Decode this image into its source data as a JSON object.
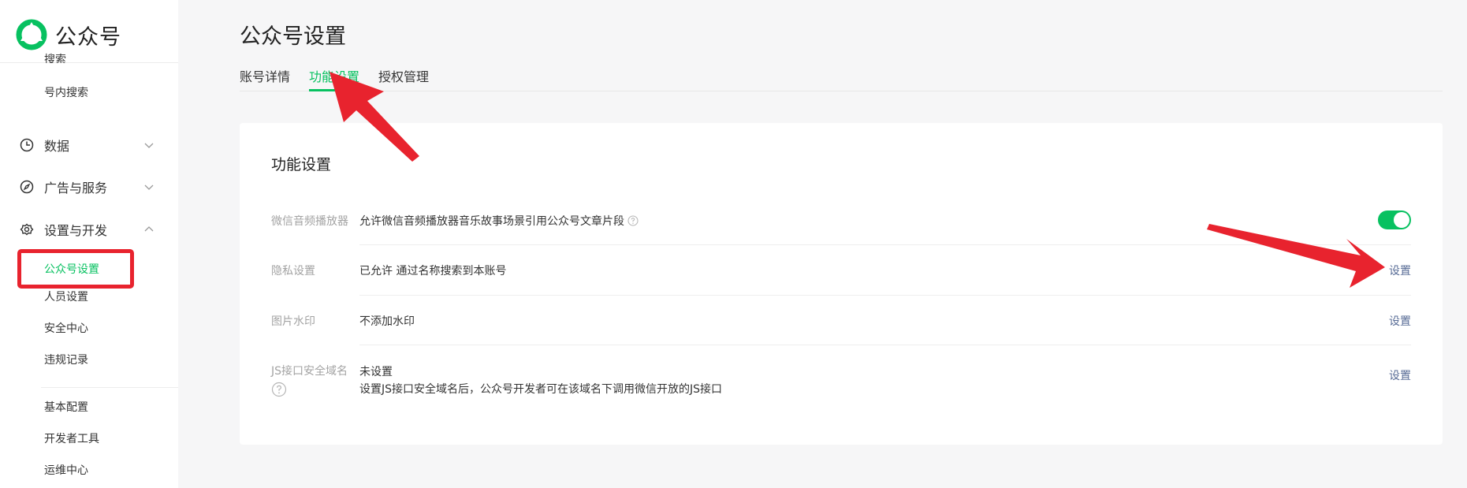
{
  "app": {
    "name": "公众号"
  },
  "sidebar": {
    "partial_item": "搜索",
    "search_item": "号内搜索",
    "groups": [
      {
        "label": "数据",
        "icon": "clock-icon",
        "expanded": false
      },
      {
        "label": "广告与服务",
        "icon": "compass-icon",
        "expanded": false
      },
      {
        "label": "设置与开发",
        "icon": "gear-icon",
        "expanded": true
      }
    ],
    "settings_items": [
      "公众号设置",
      "人员设置",
      "安全中心",
      "违规记录"
    ],
    "dev_items": [
      "基本配置",
      "开发者工具",
      "运维中心"
    ],
    "active_item": "公众号设置"
  },
  "page": {
    "title": "公众号设置",
    "tabs": [
      "账号详情",
      "功能设置",
      "授权管理"
    ],
    "active_tab": "功能设置"
  },
  "card": {
    "title": "功能设置",
    "rows": [
      {
        "label": "微信音频播放器",
        "value": "允许微信音频播放器音乐故事场景引用公众号文章片段",
        "control": "toggle",
        "toggle_on": true
      },
      {
        "label": "隐私设置",
        "value": "已允许 通过名称搜索到本账号",
        "action": "设置"
      },
      {
        "label": "图片水印",
        "value": "不添加水印",
        "action": "设置"
      },
      {
        "label": "JS接口安全域名",
        "value": "未设置",
        "description": "设置JS接口安全域名后，公众号开发者可在该域名下调用微信开放的JS接口",
        "action": "设置"
      }
    ]
  },
  "colors": {
    "accent": "#07c160",
    "link": "#576b95",
    "annotation": "#e8232e"
  }
}
